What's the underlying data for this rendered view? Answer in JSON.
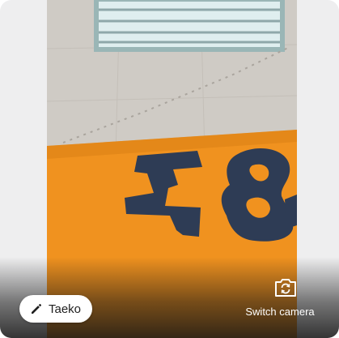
{
  "participant": {
    "name": "Taeko",
    "edit_icon": "pencil-icon"
  },
  "controls": {
    "switch_camera_label": "Switch camera",
    "switch_camera_icon": "camera-switch-icon"
  },
  "colors": {
    "tile_background": "#eeeeef",
    "wall_orange": "#f0921f",
    "letter_navy": "#2e3c55",
    "pill_background": "#ffffff"
  }
}
